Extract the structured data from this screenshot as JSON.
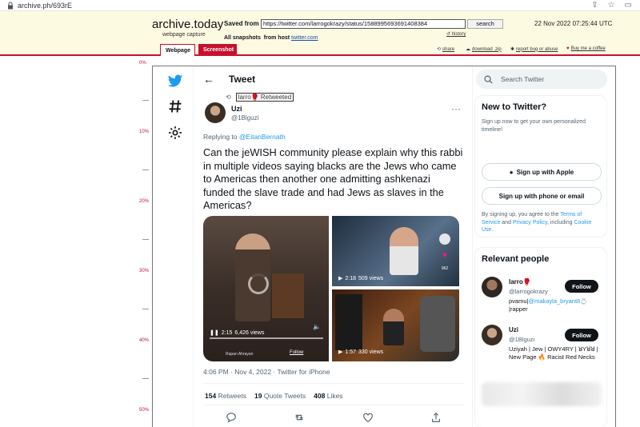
{
  "browser": {
    "url": "archive.ph/693rE"
  },
  "archive": {
    "logo": "archive.today",
    "logo_sub": "webpage capture",
    "saved_from_label": "Saved from",
    "saved_url": "https://twitter.com/larrogokrazy/status/1588995693691408384",
    "search_label": "search",
    "history_label": "history",
    "date": "22 Nov 2022 07:25:44 UTC",
    "all_snapshots_label": "All snapshots",
    "from_host_label": "from host",
    "host": "twitter.com",
    "tabs": {
      "webpage": "Webpage",
      "screenshot": "Screenshot"
    },
    "actions": {
      "share": "share",
      "download": "download .zip",
      "report": "report bug or abuse",
      "buy": "Buy me a coffee"
    },
    "accent_color": "#c8102e"
  },
  "ruler": [
    "0%",
    "10%",
    "20%",
    "30%",
    "40%",
    "50%"
  ],
  "twitter": {
    "tweet": {
      "heading": "Tweet",
      "retweeted_by": "larro🥊",
      "retweeted_label": "Retweeted",
      "author_name": "Uzi",
      "author_handle": "@1Blguzi",
      "replying_label": "Replying to",
      "replying_to": "@EitanBernath",
      "text": "Can the jeWISH community please explain why this rabbi in multiple videos saying blacks are the Jews who came to Americas then another one admitting ashkenazi funded the slave trade and had Jews as slaves in the Americas?",
      "media": {
        "video1": {
          "duration": "2:15",
          "views": "6,426 views",
          "caption": "Rapan Ahrayan",
          "follow": "Follow"
        },
        "video2": {
          "duration": "2:18",
          "views": "509 views",
          "count": "962"
        },
        "video3": {
          "duration": "1:57",
          "views": "330 views"
        }
      },
      "meta": "4:06 PM · Nov 4, 2022 · Twitter for iPhone",
      "stats": {
        "retweets_count": "154",
        "retweets_label": "Retweets",
        "quotes_count": "19",
        "quotes_label": "Quote Tweets",
        "likes_count": "408",
        "likes_label": "Likes"
      }
    },
    "search_placeholder": "Search Twitter",
    "new_to_twitter": {
      "title": "New to Twitter?",
      "subtitle": "Sign up now to get your own personalized timeline!",
      "apple_label": "Sign up with Apple",
      "phone_label": "Sign up with phone or email",
      "terms_prefix": "By signing up, you agree to the",
      "terms_link": "Terms of Service",
      "and_label": "and",
      "privacy_link": "Privacy Policy",
      "including_label": ", including",
      "cookie_link": "Cookie Use."
    },
    "relevant": {
      "title": "Relevant people",
      "people": [
        {
          "name": "larro🥊",
          "handle": "@larrogokrazy",
          "bio_prefix": "pvamu|",
          "bio_link": "@makayla_bryant8",
          "bio_suffix": "💍 |rapper",
          "follow": "Follow"
        },
        {
          "name": "Uzi",
          "handle": "@1Blguzi",
          "bio": "Uziyah | Jew | OWY4RY | ꓤYꓤꓤ | New Page 🔥 Racist Red Necks",
          "follow": "Follow"
        }
      ]
    },
    "brand_color": "#1d9bf0"
  }
}
